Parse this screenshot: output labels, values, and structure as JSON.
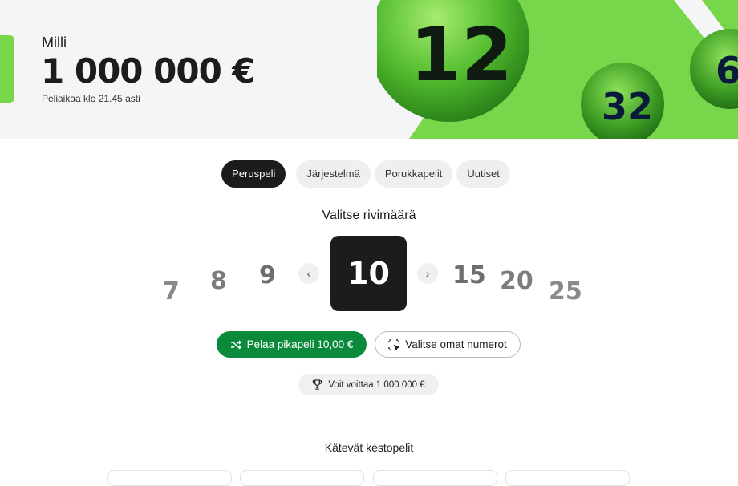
{
  "hero": {
    "game_name": "Milli",
    "jackpot": "1 000 000 €",
    "deadline": "Peliaikaa klo 21.45 asti",
    "balls": [
      "12",
      "32",
      "6"
    ],
    "accent_color": "#78d64b"
  },
  "tabs": [
    {
      "label": "Peruspeli",
      "active": true
    },
    {
      "label": "Järjestelmä",
      "active": false
    },
    {
      "label": "Porukkapelit",
      "active": false
    },
    {
      "label": "Uutiset",
      "active": false
    }
  ],
  "row_picker": {
    "title": "Valitse rivimäärä",
    "options": [
      "7",
      "8",
      "9",
      "10",
      "15",
      "20",
      "25"
    ],
    "selected": "10",
    "prev_icon": "chevron-left-icon",
    "next_icon": "chevron-right-icon"
  },
  "actions": {
    "quick_play_label": "Pelaa pikapeli 10,00 €",
    "quick_play_icon": "shuffle-icon",
    "own_numbers_label": "Valitse omat numerot",
    "own_numbers_icon": "select-icon",
    "primary_color": "#0b8a3c"
  },
  "prize": {
    "label": "Voit voittaa 1 000 000 €",
    "icon": "trophy-icon"
  },
  "subscriptions": {
    "title": "Kätevät kestopelit"
  }
}
